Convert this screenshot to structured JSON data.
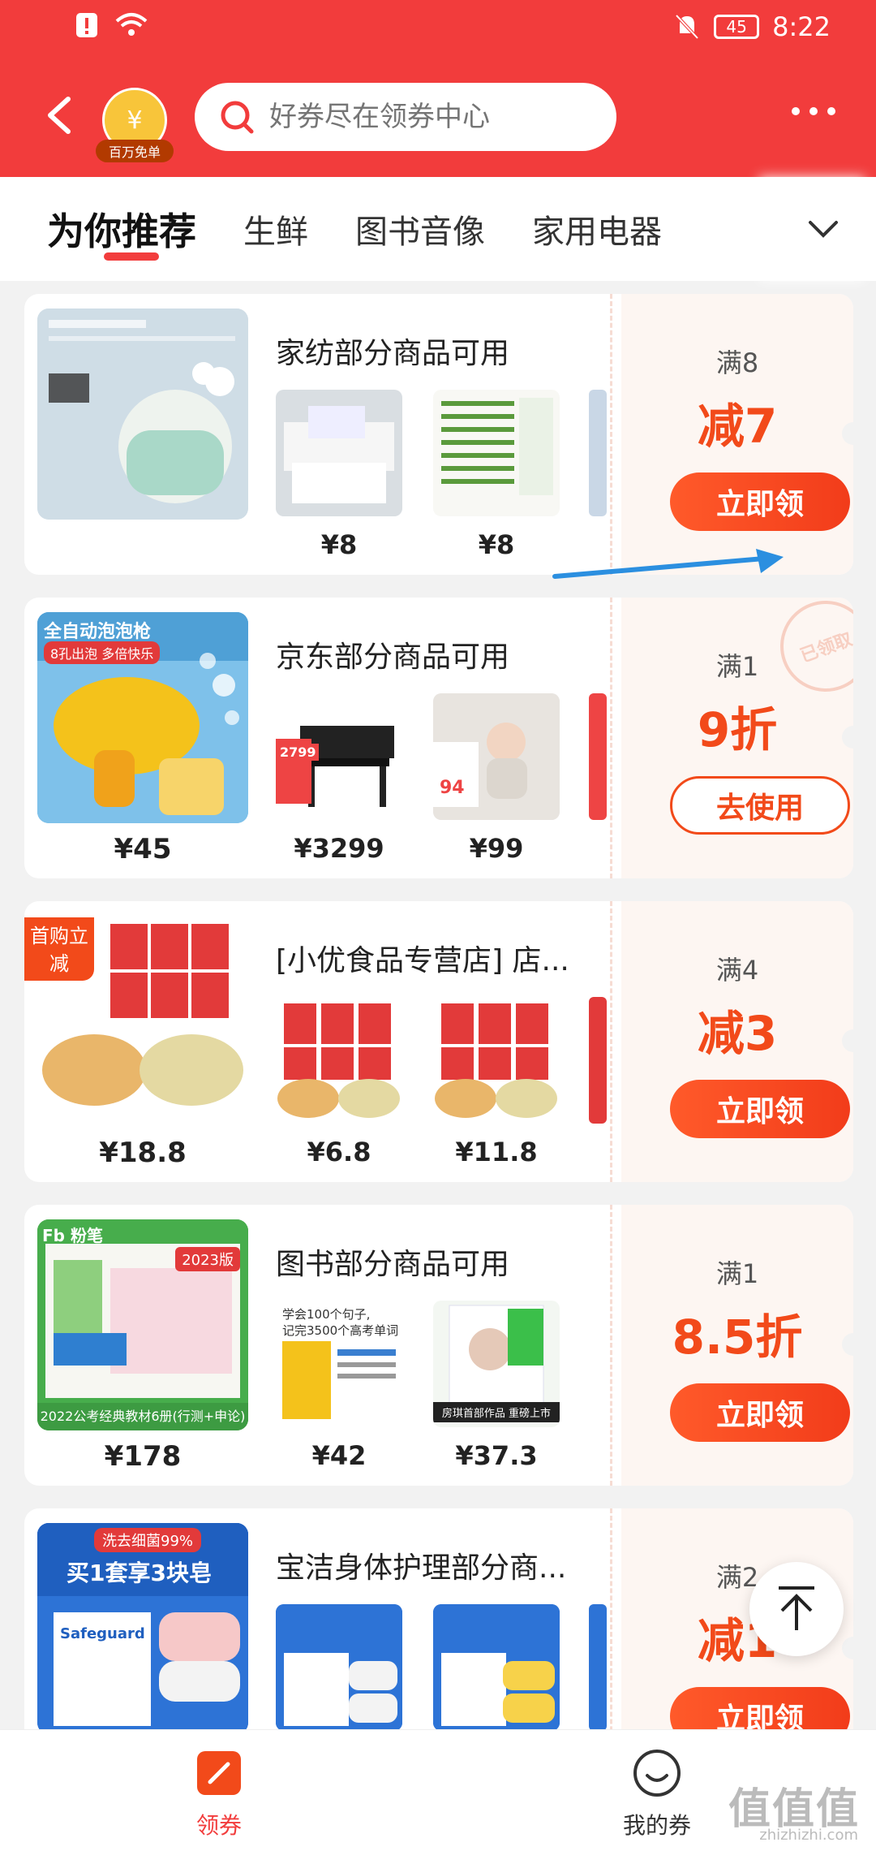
{
  "status": {
    "time": "8:22",
    "battery": "45"
  },
  "header": {
    "badge_label": "百万免单",
    "badge_symbol": "¥",
    "search_placeholder": "好券尽在领券中心"
  },
  "tabs": [
    "为你推荐",
    "生鲜",
    "图书音像",
    "家用电器"
  ],
  "coupons": [
    {
      "title": "家纺部分商品可用",
      "main_price": "",
      "thumb_prices": [
        "¥8",
        "¥8"
      ],
      "condition": "满8",
      "value": "减7",
      "button": "立即领"
    },
    {
      "title": "京东部分商品可用",
      "main_price": "¥45",
      "thumb_prices": [
        "¥3299",
        "¥99"
      ],
      "condition": "满1",
      "value": "9折",
      "button": "去使用",
      "stamp": "已领取",
      "main_img_text": "全自动泡泡枪",
      "main_img_sub": "8孔出泡 多倍快乐",
      "thumb_badge": "2799",
      "thumb_badge_2": "94"
    },
    {
      "title": "[小优食品专营店] 店...",
      "main_price": "¥18.8",
      "thumb_prices": [
        "¥6.8",
        "¥11.8"
      ],
      "condition": "满4",
      "value": "减3",
      "button": "立即领",
      "corner_tag": "首购立减"
    },
    {
      "title": "图书部分商品可用",
      "main_price": "¥178",
      "thumb_prices": [
        "¥42",
        "¥37.3"
      ],
      "condition": "满1",
      "value": "8.5折",
      "button": "立即领",
      "main_img_brand": "Fb 粉笔",
      "main_img_year": "2023版",
      "main_img_caption": "2022公考经典教材6册(行测+申论)",
      "thumb1_line1": "学会100个句子,",
      "thumb1_line2": "记完3500个高考单词",
      "thumb2_caption": "房琪首部作品 重磅上市"
    },
    {
      "title": "宝洁身体护理部分商...",
      "main_price": "",
      "thumb_prices": [
        "",
        ""
      ],
      "condition": "满2",
      "value": "减1",
      "button": "立即领",
      "main_img_banner": "洗去细菌99%",
      "main_img_text": "买1套享3块皂",
      "main_img_brand": "Safeguard"
    }
  ],
  "bottom_nav": {
    "coupons": "领券",
    "my_coupons": "我的券"
  },
  "watermark": {
    "main": "值值值",
    "sub": "zhizhizhi.com"
  },
  "colors": {
    "brand_red": "#f23c3c",
    "accent_orange": "#f24a1a"
  }
}
